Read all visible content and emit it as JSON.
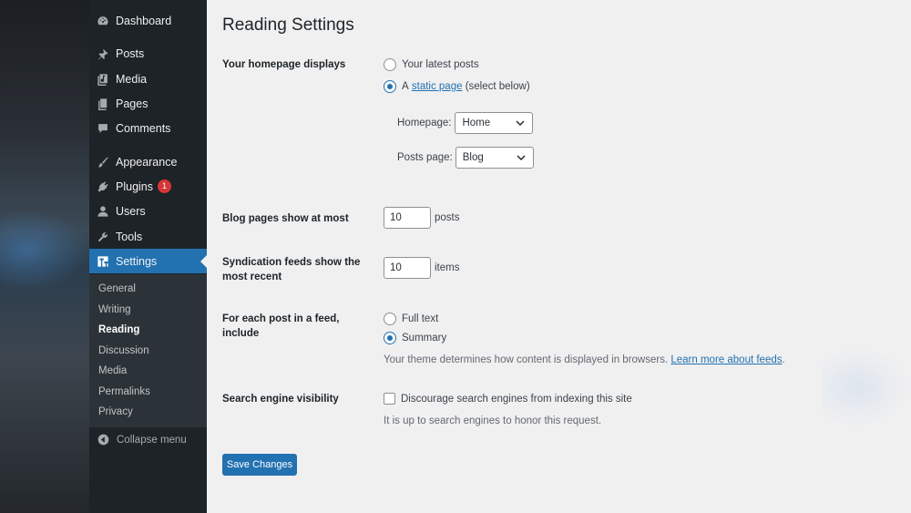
{
  "sidebar": {
    "items": [
      {
        "label": "Dashboard",
        "icon": "dashboard-icon"
      },
      {
        "label": "Posts",
        "icon": "pin-icon"
      },
      {
        "label": "Media",
        "icon": "media-icon"
      },
      {
        "label": "Pages",
        "icon": "pages-icon"
      },
      {
        "label": "Comments",
        "icon": "comment-icon"
      },
      {
        "label": "Appearance",
        "icon": "brush-icon"
      },
      {
        "label": "Plugins",
        "icon": "plugin-icon",
        "badge": "1"
      },
      {
        "label": "Users",
        "icon": "user-icon"
      },
      {
        "label": "Tools",
        "icon": "wrench-icon"
      },
      {
        "label": "Settings",
        "icon": "settings-icon",
        "active": true
      }
    ],
    "submenu": [
      "General",
      "Writing",
      "Reading",
      "Discussion",
      "Media",
      "Permalinks",
      "Privacy"
    ],
    "current_submenu": "Reading",
    "collapse_label": "Collapse menu"
  },
  "main": {
    "title": "Reading Settings",
    "homepage": {
      "label": "Your homepage displays",
      "option_latest": "Your latest posts",
      "option_static_prefix": "A",
      "option_static_link": "static page",
      "option_static_suffix": "(select below)",
      "selected": "static",
      "homepage_label": "Homepage:",
      "homepage_value": "Home",
      "posts_page_label": "Posts page:",
      "posts_page_value": "Blog"
    },
    "blog_pages": {
      "label": "Blog pages show at most",
      "value": "10",
      "unit": "posts"
    },
    "syndication": {
      "label": "Syndication feeds show the most recent",
      "value": "10",
      "unit": "items"
    },
    "feed_content": {
      "label": "For each post in a feed, include",
      "option_full": "Full text",
      "option_summary": "Summary",
      "selected": "summary",
      "desc_text": "Your theme determines how content is displayed in browsers.",
      "desc_link": "Learn more about feeds",
      "desc_end": "."
    },
    "search_visibility": {
      "label": "Search engine visibility",
      "checkbox_label": "Discourage search engines from indexing this site",
      "checked": false,
      "desc": "It is up to search engines to honor this request."
    },
    "save_label": "Save Changes"
  },
  "colors": {
    "accent": "#2271b1",
    "sidebar_bg": "#1d2327",
    "badge": "#d63638",
    "page_bg": "#f0f0f1"
  }
}
